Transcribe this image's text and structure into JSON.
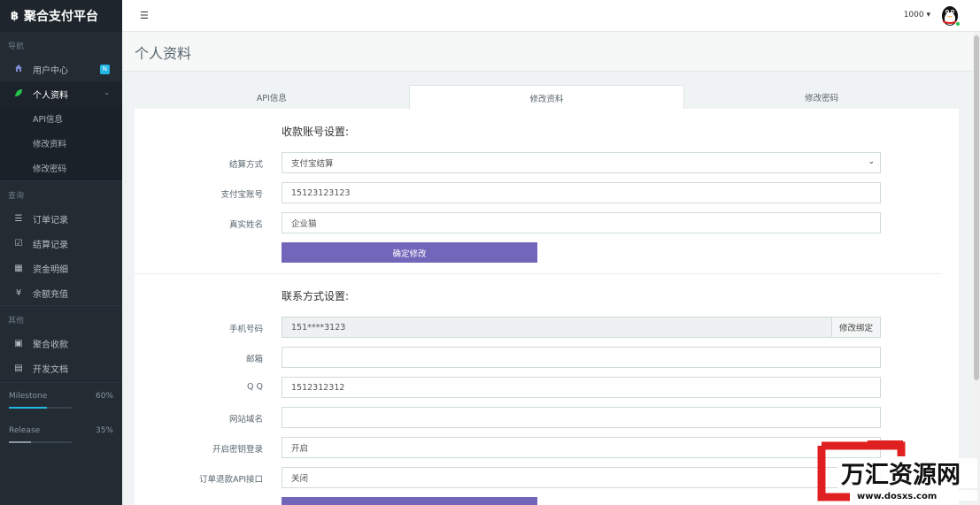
{
  "brand": {
    "icon": "฿",
    "name": "聚合支付平台"
  },
  "sidebar": {
    "section_nav": "导航",
    "section_query": "查询",
    "section_other": "其他",
    "user_center": {
      "label": "用户中心",
      "badge": "N"
    },
    "profile": {
      "label": "个人资料"
    },
    "profile_sub": [
      "API信息",
      "修改资料",
      "修改密码"
    ],
    "query_items": [
      {
        "label": "订单记录",
        "icon": "list-icon"
      },
      {
        "label": "结算记录",
        "icon": "check-square-icon"
      },
      {
        "label": "资金明细",
        "icon": "calendar-icon"
      },
      {
        "label": "余额充值",
        "icon": "yen-icon"
      }
    ],
    "other_items": [
      {
        "label": "聚合收款",
        "icon": "qrcode-icon"
      },
      {
        "label": "开发文档",
        "icon": "book-icon"
      }
    ],
    "progress": [
      {
        "label": "Milestone",
        "value": "60%",
        "fraction": 0.6,
        "color": "#23b7e5"
      },
      {
        "label": "Release",
        "value": "35%",
        "fraction": 0.35,
        "color": "#8b96a0"
      }
    ]
  },
  "header": {
    "user": "1000 ▾"
  },
  "page": {
    "title": "个人资料"
  },
  "tabs": [
    {
      "label": "API信息",
      "active": false
    },
    {
      "label": "修改资料",
      "active": true
    },
    {
      "label": "修改密码",
      "active": false
    }
  ],
  "settlement": {
    "title": "收款账号设置:",
    "method_label": "结算方式",
    "method_value": "支付宝结算",
    "account_label": "支付宝账号",
    "account_value": "15123123123",
    "name_label": "真实姓名",
    "name_value": "企业猫",
    "submit": "确定修改"
  },
  "contact": {
    "title": "联系方式设置:",
    "phone_label": "手机号码",
    "phone_value": "151****3123",
    "phone_action": "修改绑定",
    "email_label": "邮箱",
    "email_value": "",
    "qq_label": "Q Q",
    "qq_value": "1512312312",
    "site_label": "网站域名",
    "site_value": "",
    "key_login_label": "开启密钥登录",
    "key_login_value": "开启",
    "refund_label": "订单退款API接口",
    "refund_value": "关闭"
  },
  "watermark": {
    "brand": "万汇资源网",
    "url": "www.dosxs.com"
  },
  "colors": {
    "sidebar": "#232b33",
    "accent": "#7266ba",
    "info": "#23b7e5"
  }
}
